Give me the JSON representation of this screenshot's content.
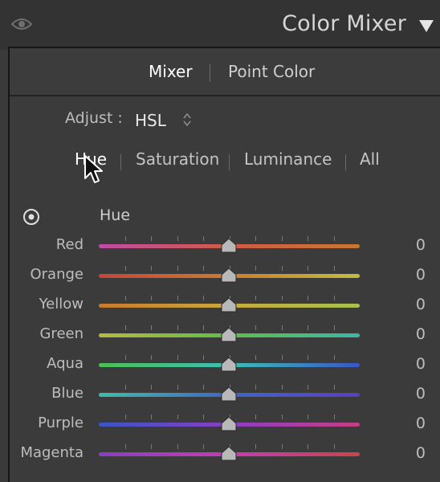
{
  "header": {
    "title": "Color Mixer"
  },
  "modes": [
    {
      "label": "Mixer",
      "active": true
    },
    {
      "label": "Point Color",
      "active": false
    }
  ],
  "adjust": {
    "label": "Adjust :",
    "value": "HSL"
  },
  "tabs": [
    {
      "label": "Hue",
      "active": true
    },
    {
      "label": "Saturation",
      "active": false
    },
    {
      "label": "Luminance",
      "active": false
    },
    {
      "label": "All",
      "active": false
    }
  ],
  "section": {
    "label": "Hue"
  },
  "sliders": [
    {
      "label": "Red",
      "value": "0",
      "colors": [
        "#c24aa6",
        "#d25a45",
        "#c9762f"
      ]
    },
    {
      "label": "Orange",
      "value": "0",
      "colors": [
        "#c6453a",
        "#cf7a2c",
        "#bfbf3e"
      ]
    },
    {
      "label": "Yellow",
      "value": "0",
      "colors": [
        "#c97a2c",
        "#c8a93a",
        "#a7c24a"
      ]
    },
    {
      "label": "Green",
      "value": "0",
      "colors": [
        "#b6ba3c",
        "#5dbf46",
        "#3ab8a6"
      ]
    },
    {
      "label": "Aqua",
      "value": "0",
      "colors": [
        "#4cbf55",
        "#3cbfb2",
        "#3a55c7"
      ]
    },
    {
      "label": "Blue",
      "value": "0",
      "colors": [
        "#3cbfa8",
        "#3f66c9",
        "#5a3ec2"
      ]
    },
    {
      "label": "Purple",
      "value": "0",
      "colors": [
        "#3a55c6",
        "#8a3ec2",
        "#c73d82"
      ]
    },
    {
      "label": "Magenta",
      "value": "0",
      "colors": [
        "#8a3ec2",
        "#c73ab6",
        "#c8444a"
      ]
    }
  ]
}
